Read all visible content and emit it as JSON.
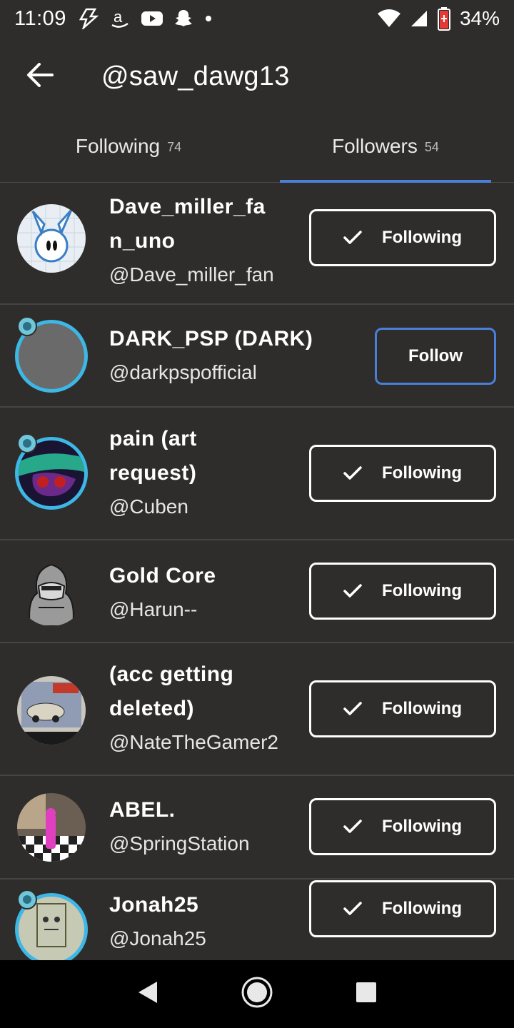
{
  "status_bar": {
    "time": "11:09",
    "battery": "34%",
    "icons": [
      "lightning-icon",
      "amazon-icon",
      "youtube-icon",
      "snapchat-icon",
      "dot-icon",
      "wifi-icon",
      "signal-icon",
      "battery-icon"
    ]
  },
  "header": {
    "title": "@saw_dawg13",
    "back_icon": "arrow-left-icon"
  },
  "tabs": [
    {
      "label": "Following",
      "count": "74",
      "active": false
    },
    {
      "label": "Followers",
      "count": "54",
      "active": true
    }
  ],
  "users": [
    {
      "name_line1": "Dave_miller_fa",
      "name_line2": "n_uno",
      "handle": "@Dave_miller_fan",
      "button": "Following"
    },
    {
      "name_line1": "DARK_PSP (DARK)",
      "handle": "@darkpspofficial",
      "button": "Follow"
    },
    {
      "name_line1": "pain (art",
      "name_line2": "request)",
      "handle": "@Cuben",
      "button": "Following"
    },
    {
      "name_line1": "Gold Core",
      "handle": "@Harun--",
      "button": "Following"
    },
    {
      "name_line1": "(acc getting",
      "name_line2": "deleted)",
      "handle": "@NateTheGamer2",
      "button": "Following"
    },
    {
      "name_line1": "ABEL.",
      "handle": "@SpringStation",
      "button": "Following"
    },
    {
      "name_line1": "Jonah25",
      "handle": "@Jonah25",
      "button": "Following"
    }
  ],
  "colors": {
    "background": "#2e2d2b",
    "accent": "#4a7fd8",
    "ring": "#3db7e6",
    "divider": "#454442"
  },
  "nav_bar": {
    "icons": [
      "back-triangle-icon",
      "home-circle-icon",
      "recents-square-icon"
    ]
  }
}
